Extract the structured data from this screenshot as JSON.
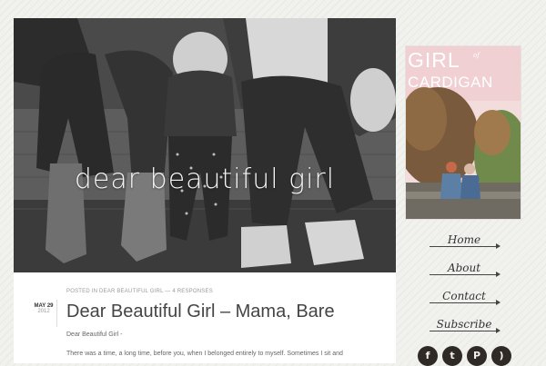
{
  "hero": {
    "title": "dear beautiful girl"
  },
  "post": {
    "meta_prefix": "POSTED IN",
    "category": "DEAR BEAUTIFUL GIRL",
    "separator": "—",
    "responses": "4 RESPONSES",
    "date_month_day": "MAY 29",
    "date_year": "2012",
    "title": "Dear Beautiful Girl – Mama, Bare",
    "salutation": "Dear Beautiful Girl -",
    "paragraph": "There was a time, a long time, before you, when I belonged entirely to myself.  Sometimes I sit and"
  },
  "sidebar": {
    "brand_top": "GIRL",
    "brand_of": "of",
    "brand_bottom": "CARDIGAN",
    "nav": [
      {
        "label": "Home"
      },
      {
        "label": "About"
      },
      {
        "label": "Contact"
      },
      {
        "label": "Subscribe"
      }
    ],
    "social": [
      {
        "icon": "facebook-icon",
        "glyph": "f"
      },
      {
        "icon": "twitter-icon",
        "glyph": "t"
      },
      {
        "icon": "pinterest-icon",
        "glyph": "P"
      },
      {
        "icon": "rss-icon",
        "glyph": ")"
      }
    ]
  },
  "colors": {
    "background": "#f1f1ee",
    "accent_dark": "#2f2a26",
    "text": "#444444"
  }
}
